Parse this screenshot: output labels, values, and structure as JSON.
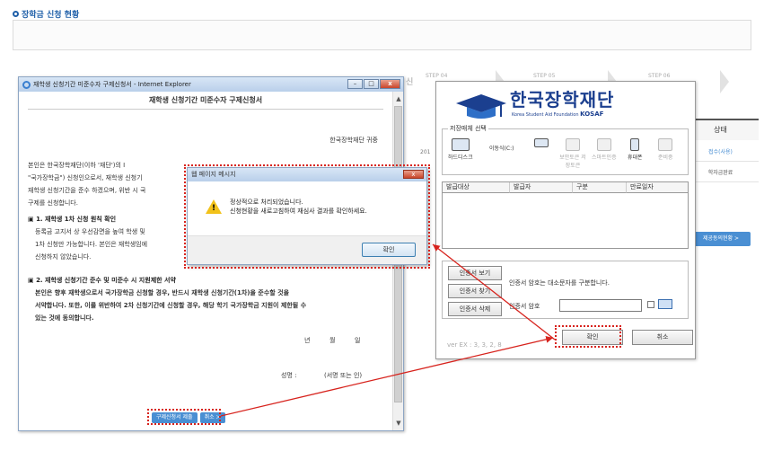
{
  "page": {
    "title": "장학금 신청 현황"
  },
  "background": {
    "steps": [
      "STEP 04",
      "STEP 05",
      "STEP 06"
    ],
    "step_prefix": "신",
    "table_header_status": "상태",
    "row_status_1": "접수(사용)",
    "row_status_2": "학자금완료",
    "row_left_1": "201",
    "consent_button": "제공동의현황 >"
  },
  "ie_window": {
    "title": "재학생 신청기간 미준수자 구제신청서 - Internet Explorer",
    "doc_title": "재학생 신청기간 미준수자 구제신청서",
    "recipient": "한국장학재단 귀중",
    "intro_lines": [
      "본인은 한국장학재단(이하 '재단')의 I",
      "\"국가장학금\") 신청인으로서, 재학생 신청기",
      "재학생 신청기간을 준수 하겠으며, 위반 시 국",
      "구제를 신청합니다."
    ],
    "section1_title": "1. 재학생 1차 신청 원칙 확인",
    "section1_lines": [
      "등록금 고지서 상 우선감면을 높여 학생 및",
      "1차 신청만 가능합니다. 본인은 재학생임에",
      "신청하지 않았습니다."
    ],
    "section2_title": "2. 재학생 신청기간 준수 및 미준수 시 지원제한 서약",
    "section2_lines": [
      "본인은 향후 재학생으로서 국가장학금 신청할 경우, 반드시 재학생 신청기간(1차)을 준수할 것을",
      "서약합니다. 또한, 이를 위반하여 2차 신청기간에 신청할 경우, 해당 학기 국가장학금 지원이 제한될 수",
      "있는 것에 동의합니다."
    ],
    "date_year": "년",
    "date_month": "월",
    "date_day": "일",
    "sign_label": "성명 :",
    "sign_hint": "(서명 또는 인)",
    "submit_button": "구제신청서 제출",
    "cancel_button": "취소 >",
    "controls": {
      "minimize": "–",
      "maximize": "□",
      "close": "x"
    }
  },
  "message_dialog": {
    "title": "웹 페이지 메시지",
    "line1": "정상적으로 처리되었습니다.",
    "line2": "신청현황을 새로고침하여 재심사 결과를 확인하세요.",
    "ok_button": "확인",
    "close": "x"
  },
  "cert_dialog": {
    "logo_title": "한국장학재단",
    "logo_subtitle": "Korea Student Aid Foundation",
    "logo_brand": "KOSAF",
    "storage_legend": "저장매체 선택",
    "devices": [
      {
        "label": "하드디스크",
        "enabled": true
      },
      {
        "label": "이동식(C:)",
        "enabled": true
      },
      {
        "label": "보안토큰 저장토큰",
        "enabled": false
      },
      {
        "label": "스마트인증",
        "enabled": false
      },
      {
        "label": "휴대폰",
        "enabled": true
      },
      {
        "label": "준비중",
        "enabled": false
      }
    ],
    "columns": [
      "발급대상",
      "발급자",
      "구분",
      "만료일자"
    ],
    "btn_view": "인증서 보기",
    "btn_find": "인증서 찾기",
    "btn_delete": "인증서 삭제",
    "note": "인증서 암호는 대소문자를 구분합니다.",
    "password_label": "인증서 암호",
    "password_value": "",
    "version": "ver EX : 3, 3, 2, 8",
    "ok_button": "확인",
    "cancel_button": "취소"
  },
  "colors": {
    "accent": "#1f5fa8",
    "button_blue": "#4a8fd3",
    "highlight_red": "#d7231d"
  }
}
